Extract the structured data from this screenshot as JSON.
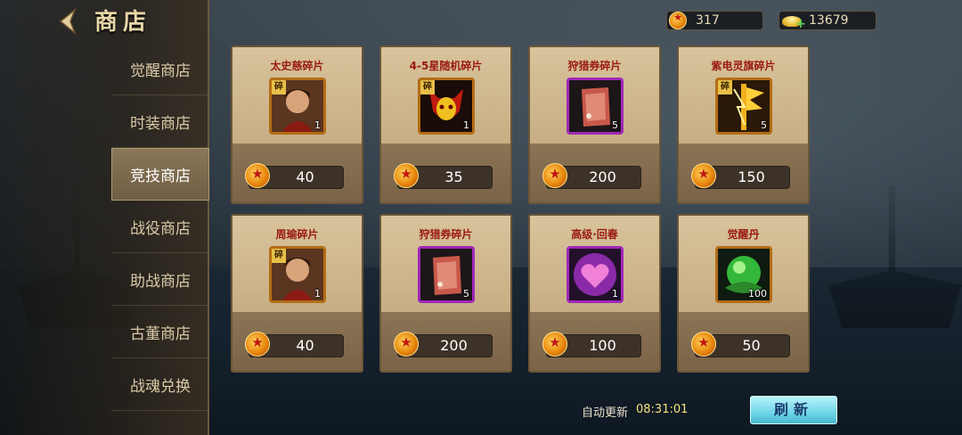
{
  "header": {
    "title": "商店"
  },
  "currency": {
    "coins": "317",
    "ingots": "13679"
  },
  "sidebar": {
    "items": [
      {
        "label": "觉醒商店",
        "active": false
      },
      {
        "label": "时装商店",
        "active": false
      },
      {
        "label": "竞技商店",
        "active": true
      },
      {
        "label": "战役商店",
        "active": false
      },
      {
        "label": "助战商店",
        "active": false
      },
      {
        "label": "古董商店",
        "active": false
      },
      {
        "label": "战魂兑换",
        "active": false
      }
    ]
  },
  "items": [
    {
      "name": "太史慈碎片",
      "count": "1",
      "price": "40",
      "icon": "hero-portrait-icon",
      "tag": "碎"
    },
    {
      "name": "4-5星随机碎片",
      "count": "1",
      "price": "35",
      "icon": "demon-mask-icon",
      "tag": "碎"
    },
    {
      "name": "狩猎券碎片",
      "count": "5",
      "price": "200",
      "icon": "hunting-ticket-icon",
      "tag": ""
    },
    {
      "name": "紫电灵旗碎片",
      "count": "5",
      "price": "150",
      "icon": "purple-lightning-flag-icon",
      "tag": "碎"
    },
    {
      "name": "周瑜碎片",
      "count": "1",
      "price": "40",
      "icon": "hero-portrait-icon",
      "tag": "碎"
    },
    {
      "name": "狩猎券碎片",
      "count": "5",
      "price": "200",
      "icon": "hunting-ticket-icon",
      "tag": ""
    },
    {
      "name": "高级·回春",
      "count": "1",
      "price": "100",
      "icon": "purple-heart-icon",
      "tag": ""
    },
    {
      "name": "觉醒丹",
      "count": "100",
      "price": "50",
      "icon": "green-orb-icon",
      "tag": ""
    }
  ],
  "footer": {
    "auto_refresh_label": "自动更新",
    "auto_refresh_time": "08:31:01",
    "refresh_label": "刷新"
  },
  "colors": {
    "item_name": "#9a1a10",
    "timer": "#f5e27a",
    "refresh_button": "#6fd6e8"
  }
}
